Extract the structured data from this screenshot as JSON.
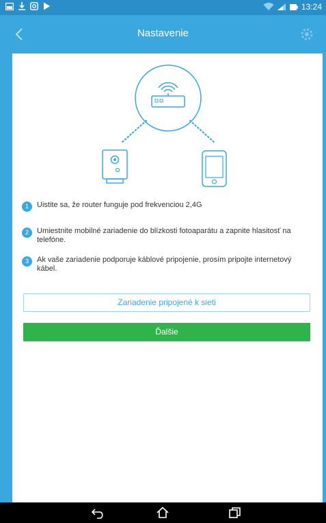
{
  "status_bar": {
    "time": "13:24",
    "icons": [
      "gallery-icon",
      "download-icon",
      "camera-icon",
      "play-store-icon",
      "wifi-icon",
      "signal-icon",
      "battery-icon"
    ]
  },
  "app_bar": {
    "title": "Nastavenie",
    "back_icon": "back-arrow-icon",
    "settings_icon": "gear-icon"
  },
  "steps": [
    {
      "number": "1",
      "text": "Uistite sa, že router funguje pod frekvenciou 2,4G"
    },
    {
      "number": "2",
      "text": "Umiestnite mobilné zariadenie do blízkosti fotoaparátu a zapnite hlasitosť na telefóne."
    },
    {
      "number": "3",
      "text": "Ak vaše zariadenie podporuje káblové pripojenie, prosím pripojte internetový kábel."
    }
  ],
  "buttons": {
    "connected": "Zariadenie pripojené k sieti",
    "next": "Ďalšie"
  },
  "colors": {
    "accent": "#3aa8de",
    "status_bar": "#2a8fc8",
    "next_button": "#2fb34b"
  }
}
